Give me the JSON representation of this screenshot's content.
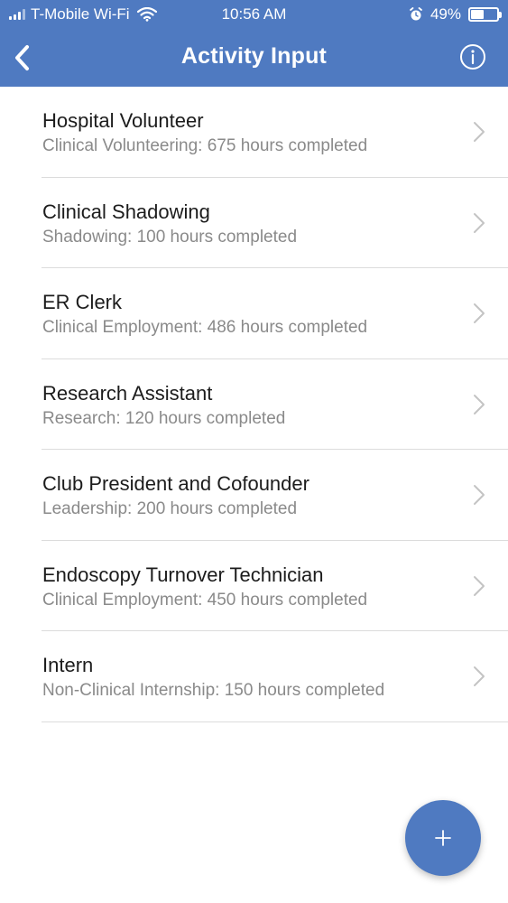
{
  "status_bar": {
    "carrier": "T-Mobile Wi-Fi",
    "time": "10:56 AM",
    "battery": "49%",
    "battery_level": 0.49
  },
  "nav": {
    "title": "Activity Input",
    "back_icon": "chevron-left-icon",
    "info_icon": "info-icon"
  },
  "activities": [
    {
      "title": "Hospital Volunteer",
      "subtitle": "Clinical Volunteering: 675 hours completed"
    },
    {
      "title": "Clinical Shadowing",
      "subtitle": "Shadowing: 100 hours completed"
    },
    {
      "title": "ER Clerk",
      "subtitle": "Clinical Employment: 486 hours completed"
    },
    {
      "title": "Research Assistant",
      "subtitle": "Research: 120 hours completed"
    },
    {
      "title": "Club President and Cofounder",
      "subtitle": "Leadership: 200 hours completed"
    },
    {
      "title": "Endoscopy Turnover Technician",
      "subtitle": "Clinical Employment: 450 hours completed"
    },
    {
      "title": "Intern",
      "subtitle": "Non-Clinical Internship: 150 hours completed"
    }
  ],
  "fab": {
    "icon": "plus-icon"
  },
  "colors": {
    "accent": "#4f7ac1"
  }
}
